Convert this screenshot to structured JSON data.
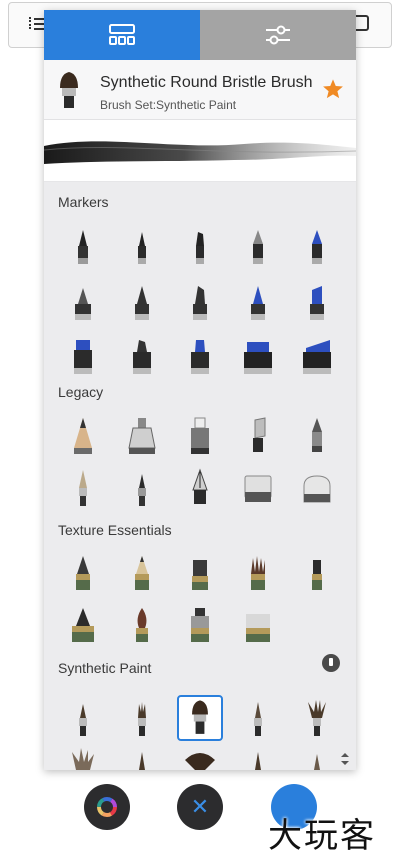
{
  "header": {
    "brush_name": "Synthetic Round Bristle Brush",
    "brush_set": "Brush Set:Synthetic Paint",
    "star_color": "#f08a24"
  },
  "tabs": [
    {
      "name": "brushes-grid-icon",
      "active": true
    },
    {
      "name": "sliders-icon",
      "active": false
    }
  ],
  "colors": {
    "accent": "#2a7fdc",
    "tab_inactive": "#a4a4a4"
  },
  "sections": [
    {
      "title": "Markers"
    },
    {
      "title": "Legacy"
    },
    {
      "title": "Texture Essentials"
    },
    {
      "title": "Synthetic Paint"
    }
  ],
  "bottom": {
    "close_glyph": "✕"
  },
  "watermark": "大玩客"
}
